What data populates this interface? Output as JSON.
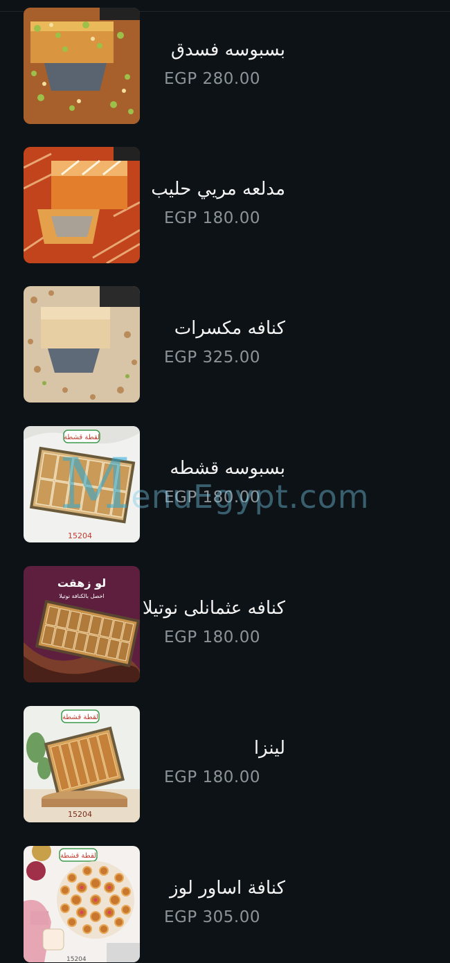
{
  "menu": {
    "items": [
      {
        "name": "بسبوسه فسدق",
        "price": "EGP 280.00"
      },
      {
        "name": "مدلعه مريي حليب",
        "price": "EGP 180.00"
      },
      {
        "name": "كنافه مكسرات",
        "price": "EGP 325.00"
      },
      {
        "name": "بسبوسه قشطه",
        "price": "EGP 180.00"
      },
      {
        "name": "كنافه عثمانلى نوتيلا",
        "price": "EGP 180.00"
      },
      {
        "name": "لينزا",
        "price": "EGP 180.00"
      },
      {
        "name": "كنافة اساور لوز",
        "price": "EGP 305.00"
      }
    ]
  },
  "images": {
    "item4_brand": "لقطة قشطة",
    "item4_code": "15204",
    "item5_title": "لو زهقت",
    "item5_sub": "اخصل بالكنافة نوتيلا",
    "item6_brand": "لقطة قشطة",
    "item6_code": "15204",
    "item7_brand": "لقطة قشطة",
    "item7_code": "15204"
  },
  "watermark": {
    "lead": "M",
    "rest": "enuEgypt.com"
  }
}
